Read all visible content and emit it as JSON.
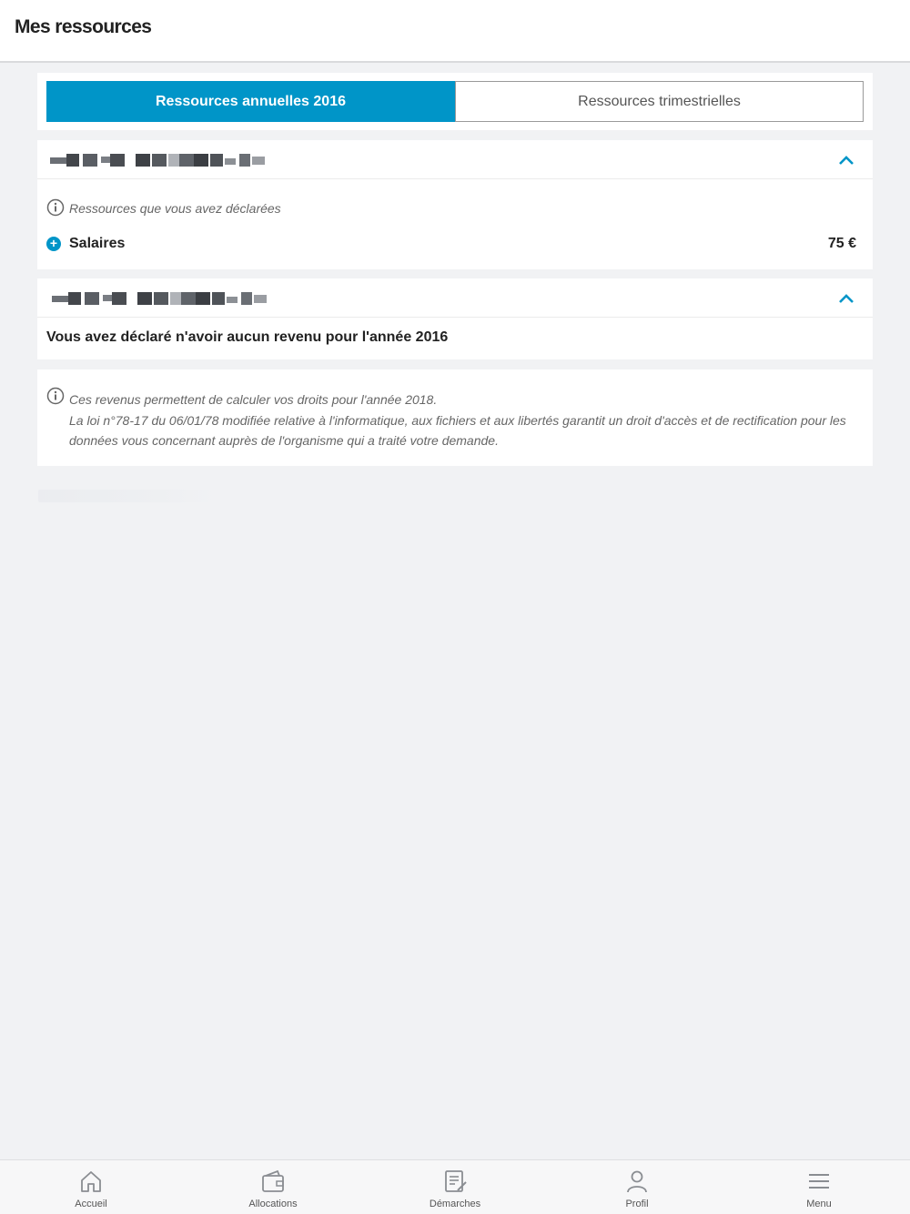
{
  "header": {
    "title": "Mes ressources"
  },
  "tabs": [
    {
      "label": "Ressources annuelles 2016",
      "active": true
    },
    {
      "label": "Ressources trimestrielles",
      "active": false
    }
  ],
  "section1": {
    "note": "Ressources que vous avez déclarées",
    "item": {
      "label": "Salaires",
      "value": "75 €"
    }
  },
  "section2": {
    "statement": "Vous avez déclaré n'avoir aucun revenu pour l'année 2016"
  },
  "info": {
    "lines": [
      "Ces revenus permettent de calculer vos droits pour l'année 2018.",
      "La loi n°78-17 du 06/01/78 modifiée relative à l'informatique, aux fichiers et aux libertés garantit un droit d'accès et de rectification pour les",
      "données vous concernant auprès de l'organisme qui a traité votre demande."
    ]
  },
  "nav": {
    "items": [
      {
        "label": "Accueil",
        "icon": "home-icon"
      },
      {
        "label": "Allocations",
        "icon": "wallet-icon"
      },
      {
        "label": "Démarches",
        "icon": "document-edit-icon"
      },
      {
        "label": "Profil",
        "icon": "user-icon"
      },
      {
        "label": "Menu",
        "icon": "hamburger-icon"
      }
    ]
  },
  "colors": {
    "accent": "#0095c8",
    "background": "#f1f2f4"
  }
}
